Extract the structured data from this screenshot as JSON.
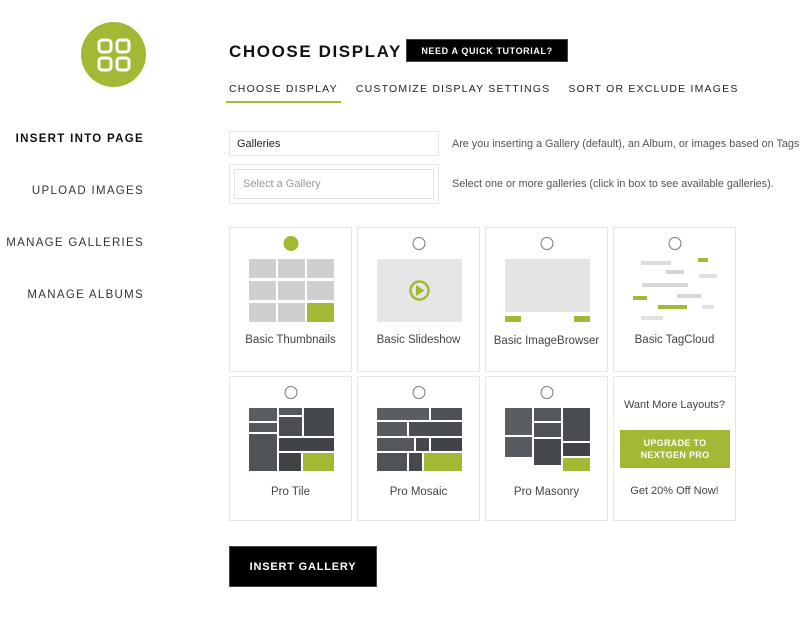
{
  "brand": {
    "icon": "grid-icon",
    "accent": "#a1b935"
  },
  "sidebar": {
    "items": [
      {
        "label": "INSERT INTO PAGE",
        "active": true
      },
      {
        "label": "UPLOAD IMAGES",
        "active": false
      },
      {
        "label": "MANAGE GALLERIES",
        "active": false
      },
      {
        "label": "MANAGE ALBUMS",
        "active": false
      }
    ]
  },
  "header": {
    "title": "CHOOSE DISPLAY",
    "tutorial_label": "NEED A QUICK TUTORIAL?"
  },
  "tabs": [
    {
      "label": "CHOOSE DISPLAY",
      "active": true
    },
    {
      "label": "CUSTOMIZE DISPLAY SETTINGS",
      "active": false
    },
    {
      "label": "SORT OR EXCLUDE IMAGES",
      "active": false
    }
  ],
  "form": {
    "source": {
      "value": "Galleries",
      "hint": "Are you inserting a Gallery (default), an Album, or images based on Tags?"
    },
    "galleries": {
      "placeholder": "Select a Gallery",
      "hint": "Select one or more galleries (click in box to see available galleries)."
    }
  },
  "displays": [
    {
      "label": "Basic Thumbnails",
      "selected": true
    },
    {
      "label": "Basic Slideshow",
      "selected": false
    },
    {
      "label": "Basic ImageBrowser",
      "selected": false
    },
    {
      "label": "Basic TagCloud",
      "selected": false
    },
    {
      "label": "Pro Tile",
      "selected": false
    },
    {
      "label": "Pro Mosaic",
      "selected": false
    },
    {
      "label": "Pro Masonry",
      "selected": false
    }
  ],
  "promo": {
    "title": "Want More Layouts?",
    "button_label": "UPGRADE TO NEXTGEN PRO",
    "subtitle": "Get 20% Off Now!"
  },
  "insert_label": "INSERT GALLERY"
}
